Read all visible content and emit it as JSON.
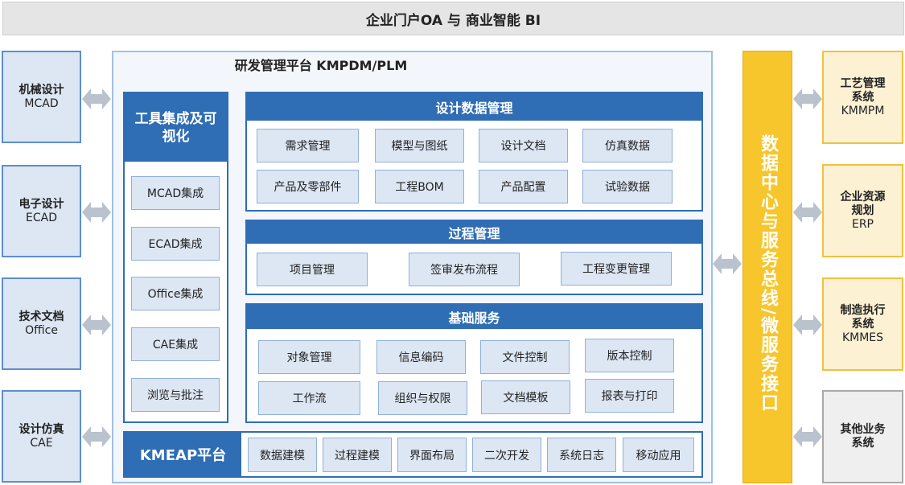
{
  "top_bar": "企业门户OA 与 商业智能 BI",
  "platform_title": "研发管理平台 KMPDM/PLM",
  "left_systems": [
    {
      "name": "机械设计",
      "code": "MCAD"
    },
    {
      "name": "电子设计",
      "code": "ECAD"
    },
    {
      "name": "技术文档",
      "code": "Office"
    },
    {
      "name": "设计仿真",
      "code": "CAE"
    }
  ],
  "tools": {
    "title": "工具集成及可视化",
    "items": [
      "MCAD集成",
      "ECAD集成",
      "Office集成",
      "CAE集成",
      "浏览与批注"
    ]
  },
  "design_data": {
    "title": "设计数据管理",
    "items": [
      "需求管理",
      "模型与图纸",
      "设计文档",
      "仿真数据",
      "产品及零部件",
      "工程BOM",
      "产品配置",
      "试验数据"
    ]
  },
  "process": {
    "title": "过程管理",
    "items": [
      "项目管理",
      "签审发布流程",
      "工程变更管理"
    ]
  },
  "base_services": {
    "title": "基础服务",
    "items": [
      "对象管理",
      "信息编码",
      "文件控制",
      "版本控制",
      "工作流",
      "组织与权限",
      "文档模板",
      "报表与打印"
    ]
  },
  "kmeap": {
    "title": "KMEAP平台",
    "items": [
      "数据建模",
      "过程建模",
      "界面布局",
      "二次开发",
      "系统日志",
      "移动应用"
    ]
  },
  "bus": "数据中心与服务总线/微服务接口",
  "right_systems": [
    {
      "name": "工艺管理系统",
      "code": "KMMPM"
    },
    {
      "name": "企业资源规划",
      "code": "ERP"
    },
    {
      "name": "制造执行系统",
      "code": "KMMES"
    },
    {
      "name": "其他业务系统",
      "code": ""
    }
  ],
  "colors": {
    "primary_blue": "#2f6db5",
    "light_blue": "#dde6f3",
    "bus_yellow": "#f7c52c",
    "right_bg": "#fdf1d4",
    "arrow_gray": "#b9c2cd"
  }
}
